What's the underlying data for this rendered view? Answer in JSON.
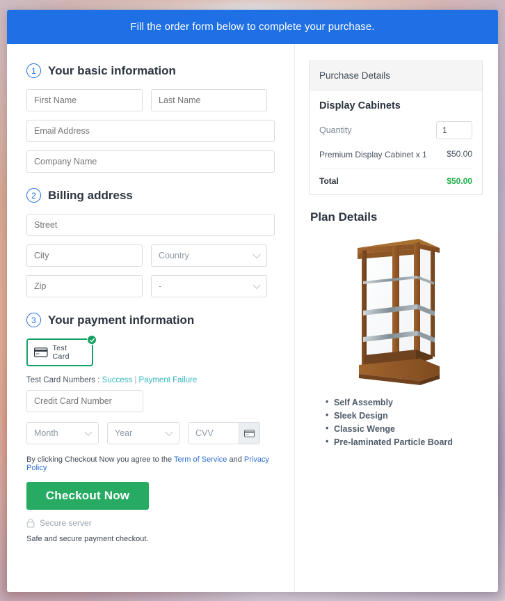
{
  "banner": {
    "text": "Fill the order form below to complete your purchase."
  },
  "sections": {
    "basic": {
      "number": "1",
      "title": "Your basic information",
      "fields": {
        "first_name": "First Name",
        "last_name": "Last Name",
        "email": "Email Address",
        "company": "Company Name"
      }
    },
    "billing": {
      "number": "2",
      "title": "Billing address",
      "fields": {
        "street": "Street",
        "city": "City",
        "country": "Country",
        "zip": "Zip",
        "state": "-"
      }
    },
    "payment": {
      "number": "3",
      "title": "Your payment information",
      "method": {
        "label": "Test Card",
        "icon": "credit-card-icon",
        "selected": true
      },
      "test_cards": {
        "prefix": "Test Card Numbers :",
        "success": "Success",
        "separator": "|",
        "failure": "Payment Failure"
      },
      "fields": {
        "card_number": "Credit Card Number",
        "month": "Month",
        "year": "Year",
        "cvv": "CVV"
      }
    }
  },
  "footer": {
    "terms_prefix": "By clicking Checkout Now you agree to the",
    "terms_link": "Term of Service",
    "terms_and": "and",
    "privacy_link": "Privacy Policy",
    "checkout_button": "Checkout Now",
    "secure_server": "Secure server",
    "safe_note": "Safe and secure payment checkout."
  },
  "purchase": {
    "header": "Purchase Details",
    "product": "Display Cabinets",
    "quantity_label": "Quantity",
    "quantity_value": "1",
    "line_item": {
      "desc": "Premium Display Cabinet x 1",
      "price": "$50.00"
    },
    "total_label": "Total",
    "total_value": "$50.00"
  },
  "plan": {
    "title": "Plan Details",
    "image_alt": "display-cabinet-photo",
    "features": [
      "Self Assembly",
      "Sleek Design",
      "Classic Wenge",
      "Pre-laminated Particle Board"
    ]
  },
  "colors": {
    "banner_blue": "#1f6fe5",
    "accent_green": "#27ab63",
    "total_green": "#22b14c",
    "link_teal": "#36b5bf",
    "link_blue": "#2f6fd0",
    "wood_brown": "#8b5a2b"
  }
}
